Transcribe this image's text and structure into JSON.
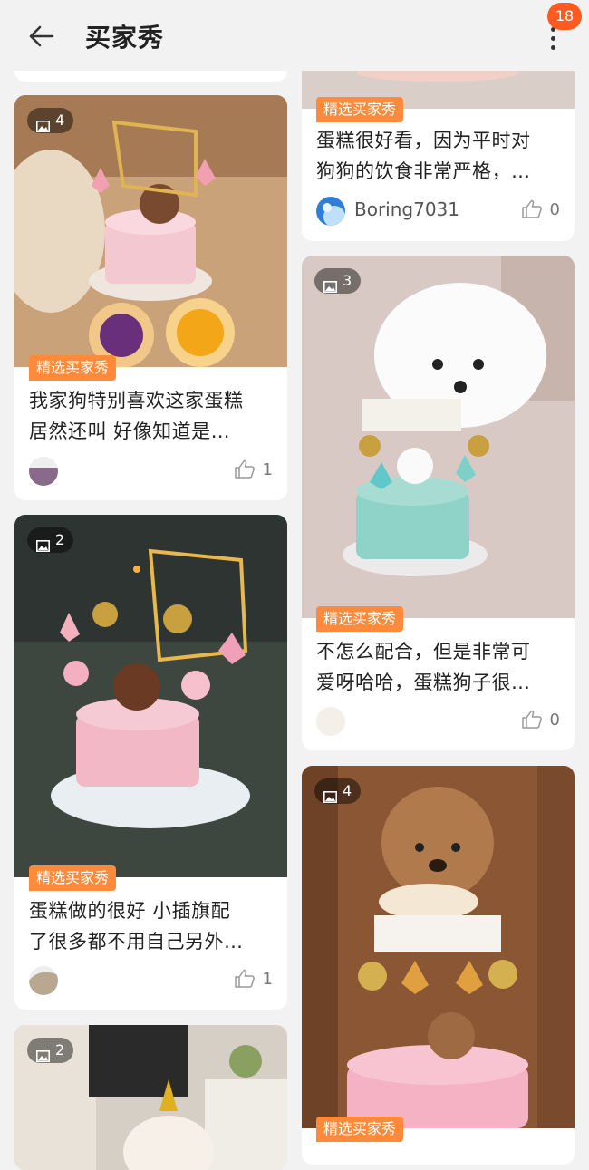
{
  "header": {
    "title": "买家秀",
    "badge": "18"
  },
  "tag_label": "精选买家秀",
  "cards": [
    {
      "count": "4",
      "caption_l1": "我家狗特别喜欢这家蛋糕",
      "caption_l2": "居然还叫 好像知道是…",
      "user": "",
      "likes": "1"
    },
    {
      "count": "2",
      "caption_l1": "蛋糕做的很好 小插旗配",
      "caption_l2": "了很多都不用自己另外…",
      "user": "",
      "likes": "1"
    },
    {
      "count": "2"
    },
    {
      "caption_l1": "蛋糕很好看，因为平时对",
      "caption_l2": "狗狗的饮食非常严格，…",
      "user": "Boring7031",
      "likes": "0"
    },
    {
      "count": "3",
      "caption_l1": "不怎么配合，但是非常可",
      "caption_l2": "爱呀哈哈，蛋糕狗子很…",
      "user": "",
      "likes": "0"
    },
    {
      "count": "4"
    }
  ],
  "colors": {
    "accent": "#ff5a1f",
    "tag": "#ff8a3a",
    "background": "#f2f2f2"
  }
}
